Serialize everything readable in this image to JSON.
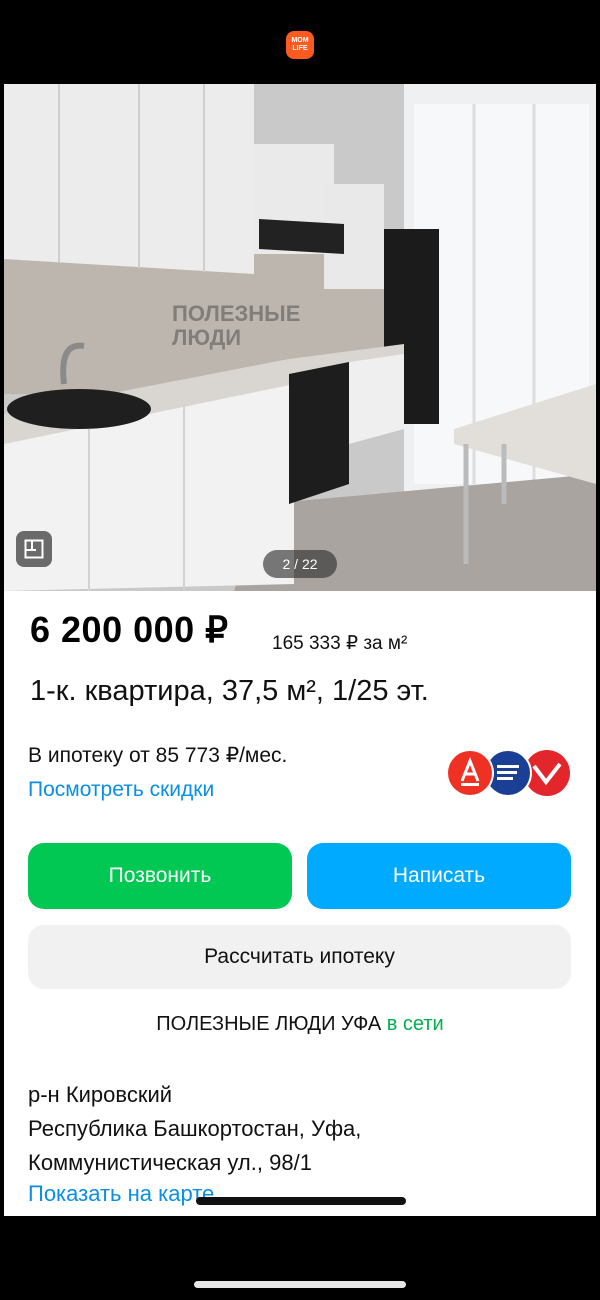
{
  "app": {
    "logo_text_line1": "MOM",
    "logo_text_line2": "LIFE",
    "icon": "app-logo-icon"
  },
  "gallery": {
    "counter": "2 / 22",
    "watermark_line1": "ПОЛЕЗНЫЕ",
    "watermark_line2": "ЛЮДИ",
    "floorplan_icon": "floorplan-icon"
  },
  "listing": {
    "price": "6 200 000 ₽",
    "price_per_m2": "165 333 ₽ за м²",
    "title": "1-к. квартира, 37,5 м², 1/25 эт.",
    "mortgage_text": "В ипотеку от 85 773 ₽/мес.",
    "discounts_link": "Посмотреть скидки",
    "bank_colors": [
      "#ef3124",
      "#1a3f94",
      "#e3262c"
    ]
  },
  "actions": {
    "call_label": "Позвонить",
    "write_label": "Написать",
    "calc_label": "Рассчитать ипотеку",
    "call_color": "#00c853",
    "write_color": "#00aaff"
  },
  "seller": {
    "name": "ПОЛЕЗНЫЕ ЛЮДИ УФА",
    "status": "в сети"
  },
  "address": {
    "district": "р-н Кировский",
    "line1": "Республика Башкортостан, Уфа,",
    "line2": "Коммунистическая ул., 98/1",
    "map_link": "Показать на карте"
  }
}
